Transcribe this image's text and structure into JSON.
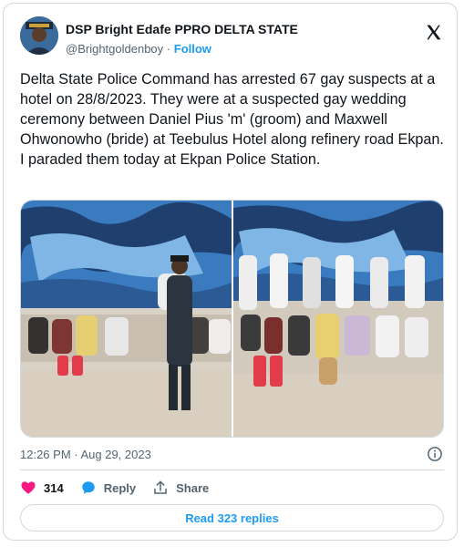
{
  "author": {
    "display_name": "DSP Bright Edafe PPRO DELTA STATE",
    "handle": "@Brightgoldenboy",
    "separator": "·",
    "follow_label": "Follow"
  },
  "tweet": {
    "text": "Delta State Police Command has arrested 67 gay suspects at a hotel on 28/8/2023. They were at a suspected gay wedding ceremony between Daniel Pius 'm' (groom) and Maxwell Ohwonowho (bride) at Teebulus Hotel along refinery road Ekpan. I paraded them today at Ekpan Police Station.",
    "timestamp": "12:26 PM · Aug 29, 2023"
  },
  "actions": {
    "like_count": "314",
    "reply_label": "Reply",
    "share_label": "Share",
    "read_replies_label": "Read 323 replies"
  },
  "icons": {
    "x_logo": "x-logo-icon",
    "like": "heart-icon",
    "reply": "speech-bubble-icon",
    "share": "share-upload-icon",
    "info": "info-circle-icon"
  },
  "colors": {
    "accent": "#1d9bf0",
    "like": "#f91880",
    "text": "#0f1419",
    "muted": "#536471",
    "border": "#cfd9de"
  }
}
